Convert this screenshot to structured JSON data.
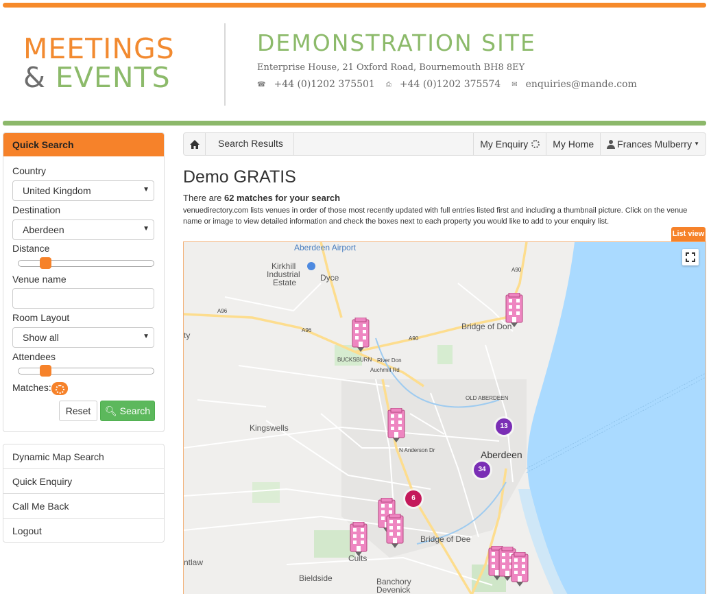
{
  "header": {
    "logo_line1": "MEETINGS",
    "logo_amp": "&",
    "logo_line2": "EVENTS",
    "site_title": "DEMONSTRATION SITE",
    "address": "Enterprise House, 21 Oxford Road, Bournemouth BH8 8EY",
    "phone": "+44 (0)1202 375501",
    "fax": "+44 (0)1202 375574",
    "email": "enquiries@mande.com"
  },
  "sidebar": {
    "title": "Quick Search",
    "country_label": "Country",
    "country_value": "United Kingdom",
    "destination_label": "Destination",
    "destination_value": "Aberdeen",
    "distance_label": "Distance",
    "distance_level": 0.17,
    "venue_label": "Venue name",
    "venue_value": "",
    "layout_label": "Room Layout",
    "layout_value": "Show all",
    "attendees_label": "Attendees",
    "attendees_level": 0.17,
    "matches_label": "Matches:",
    "reset_label": "Reset",
    "search_label": "Search",
    "menu": [
      "Dynamic Map Search",
      "Quick Enquiry",
      "Call Me Back",
      "Logout"
    ]
  },
  "nav": {
    "crumb": "Search Results",
    "my_enquiry": "My Enquiry",
    "my_home": "My Home",
    "user": "Frances Mulberry"
  },
  "main": {
    "title": "Demo GRATIS",
    "match_prefix": "There are ",
    "match_bold": "62 matches for your search",
    "description": "venuedirectory.com lists venues in order of those most recently updated with full entries listed first and including a thumbnail picture. Click on the venue name or image to view detailed information and check the boxes next to each property you would like to add to your enquiry list.",
    "list_view": "List view"
  },
  "map": {
    "labels": {
      "airport": "Aberdeen Airport",
      "kirkhill": "Kirkhill",
      "industrial": "Industrial",
      "estate": "Estate",
      "dyce": "Dyce",
      "a96_left": "A96",
      "a96_mid": "A96",
      "a90_mid": "A90",
      "a90_top": "A90",
      "bridge_don": "Bridge of Don",
      "bucksburn": "BUCKSBURN",
      "river_don": "River Don",
      "auchmill": "Auchmill Rd",
      "old_aberdeen": "OLD ABERDEEN",
      "kingswells": "Kingswells",
      "n_anderson": "N Anderson Dr",
      "aberdeen": "Aberdeen",
      "bridge_dee": "Bridge of Dee",
      "cults": "Cults",
      "bieldside": "Bieldside",
      "banchory": "Banchory",
      "devenick": "Devenick",
      "ntlaw": "ntlaw",
      "ty": "ty"
    },
    "clusters": [
      {
        "count": "13",
        "color": "purple"
      },
      {
        "count": "34",
        "color": "purple"
      },
      {
        "count": "6",
        "color": "pink"
      }
    ]
  }
}
